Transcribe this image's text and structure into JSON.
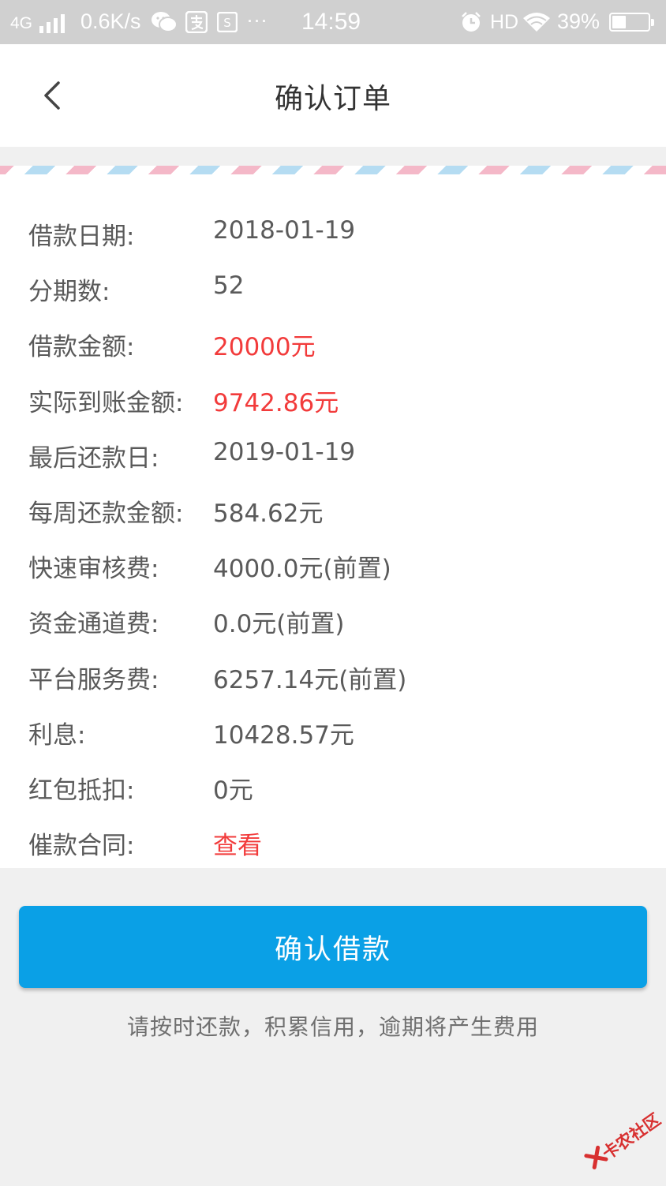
{
  "status_bar": {
    "network": "4G",
    "speed": "0.6K/s",
    "more": "···",
    "time": "14:59",
    "hd": "HD",
    "battery": "39%",
    "battery_level": 0.39,
    "icons": [
      "signal-icon",
      "wechat-icon",
      "alipay-icon",
      "card-icon",
      "alarm-icon",
      "wifi-icon",
      "battery-icon"
    ]
  },
  "navbar": {
    "title": "确认订单",
    "back_icon": "chevron-left-icon"
  },
  "order_details": [
    {
      "label": "借款日期:",
      "value": "2018-01-19",
      "highlight": false
    },
    {
      "label": "分期数:",
      "value": "52",
      "highlight": false
    },
    {
      "label": "借款金额:",
      "value": "20000元",
      "highlight": true
    },
    {
      "label": "实际到账金额:",
      "value": "9742.86元",
      "highlight": true
    },
    {
      "label": "最后还款日:",
      "value": "2019-01-19",
      "highlight": false
    },
    {
      "label": "每周还款金额:",
      "value": "584.62元",
      "highlight": false
    },
    {
      "label": "快速审核费:",
      "value": "4000.0元(前置)",
      "highlight": false
    },
    {
      "label": "资金通道费:",
      "value": "0.0元(前置)",
      "highlight": false
    },
    {
      "label": "平台服务费:",
      "value": "6257.14元(前置)",
      "highlight": false
    },
    {
      "label": "利息:",
      "value": "10428.57元",
      "highlight": false
    },
    {
      "label": "红包抵扣:",
      "value": "0元",
      "highlight": false
    },
    {
      "label": "催款合同:",
      "value": "查看",
      "highlight": true,
      "link": true
    }
  ],
  "actions": {
    "confirm_label": "确认借款"
  },
  "tip": "请按时还款，积累信用，逾期将产生费用",
  "watermark": "卡农社区",
  "colors": {
    "accent": "#0aa0e6",
    "highlight": "#f23b3b",
    "text": "#5a5a5a"
  }
}
